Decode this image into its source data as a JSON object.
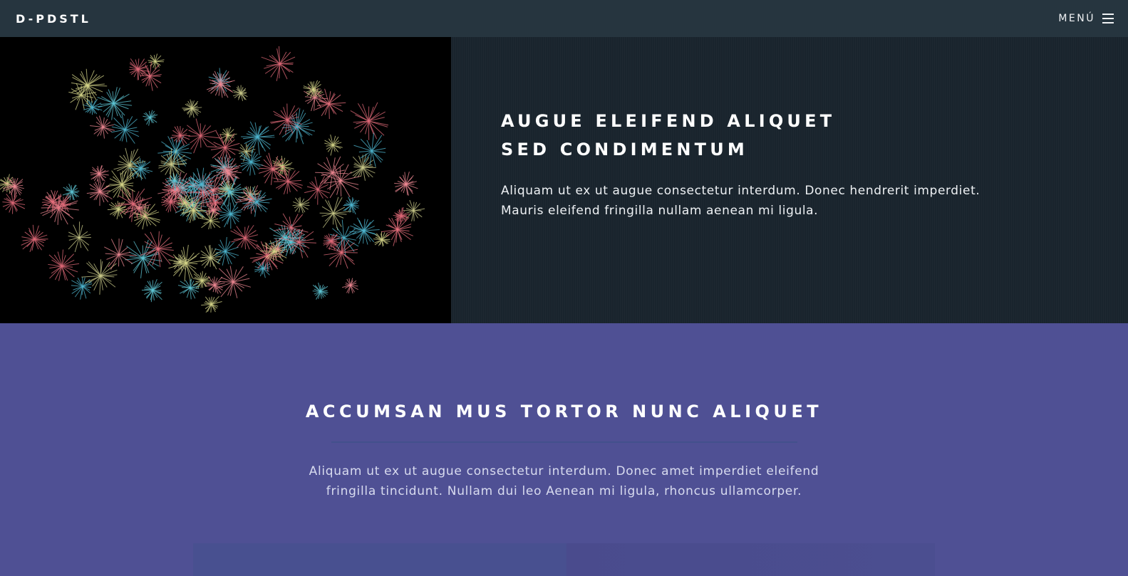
{
  "header": {
    "brand": "D-PDSTL",
    "menu_label": "MENÚ"
  },
  "hero": {
    "title_line1": "AUGUE ELEIFEND ALIQUET",
    "title_line2": "SED CONDIMENTUM",
    "text": "Aliquam ut ex ut augue consectetur interdum. Donec hendrerit imperdiet. Mauris eleifend fringilla nullam aenean mi ligula."
  },
  "section": {
    "title": "ACCUMSAN MUS TORTOR NUNC ALIQUET",
    "text": "Aliquam ut ex ut augue consectetur interdum. Donec amet imperdiet eleifend fringilla tincidunt. Nullam dui leo Aenean mi ligula, rhoncus ullamcorper."
  },
  "colors": {
    "header_bg": "#26353f",
    "hero_bg": "#19242d",
    "section_bg": "#4f5094"
  }
}
